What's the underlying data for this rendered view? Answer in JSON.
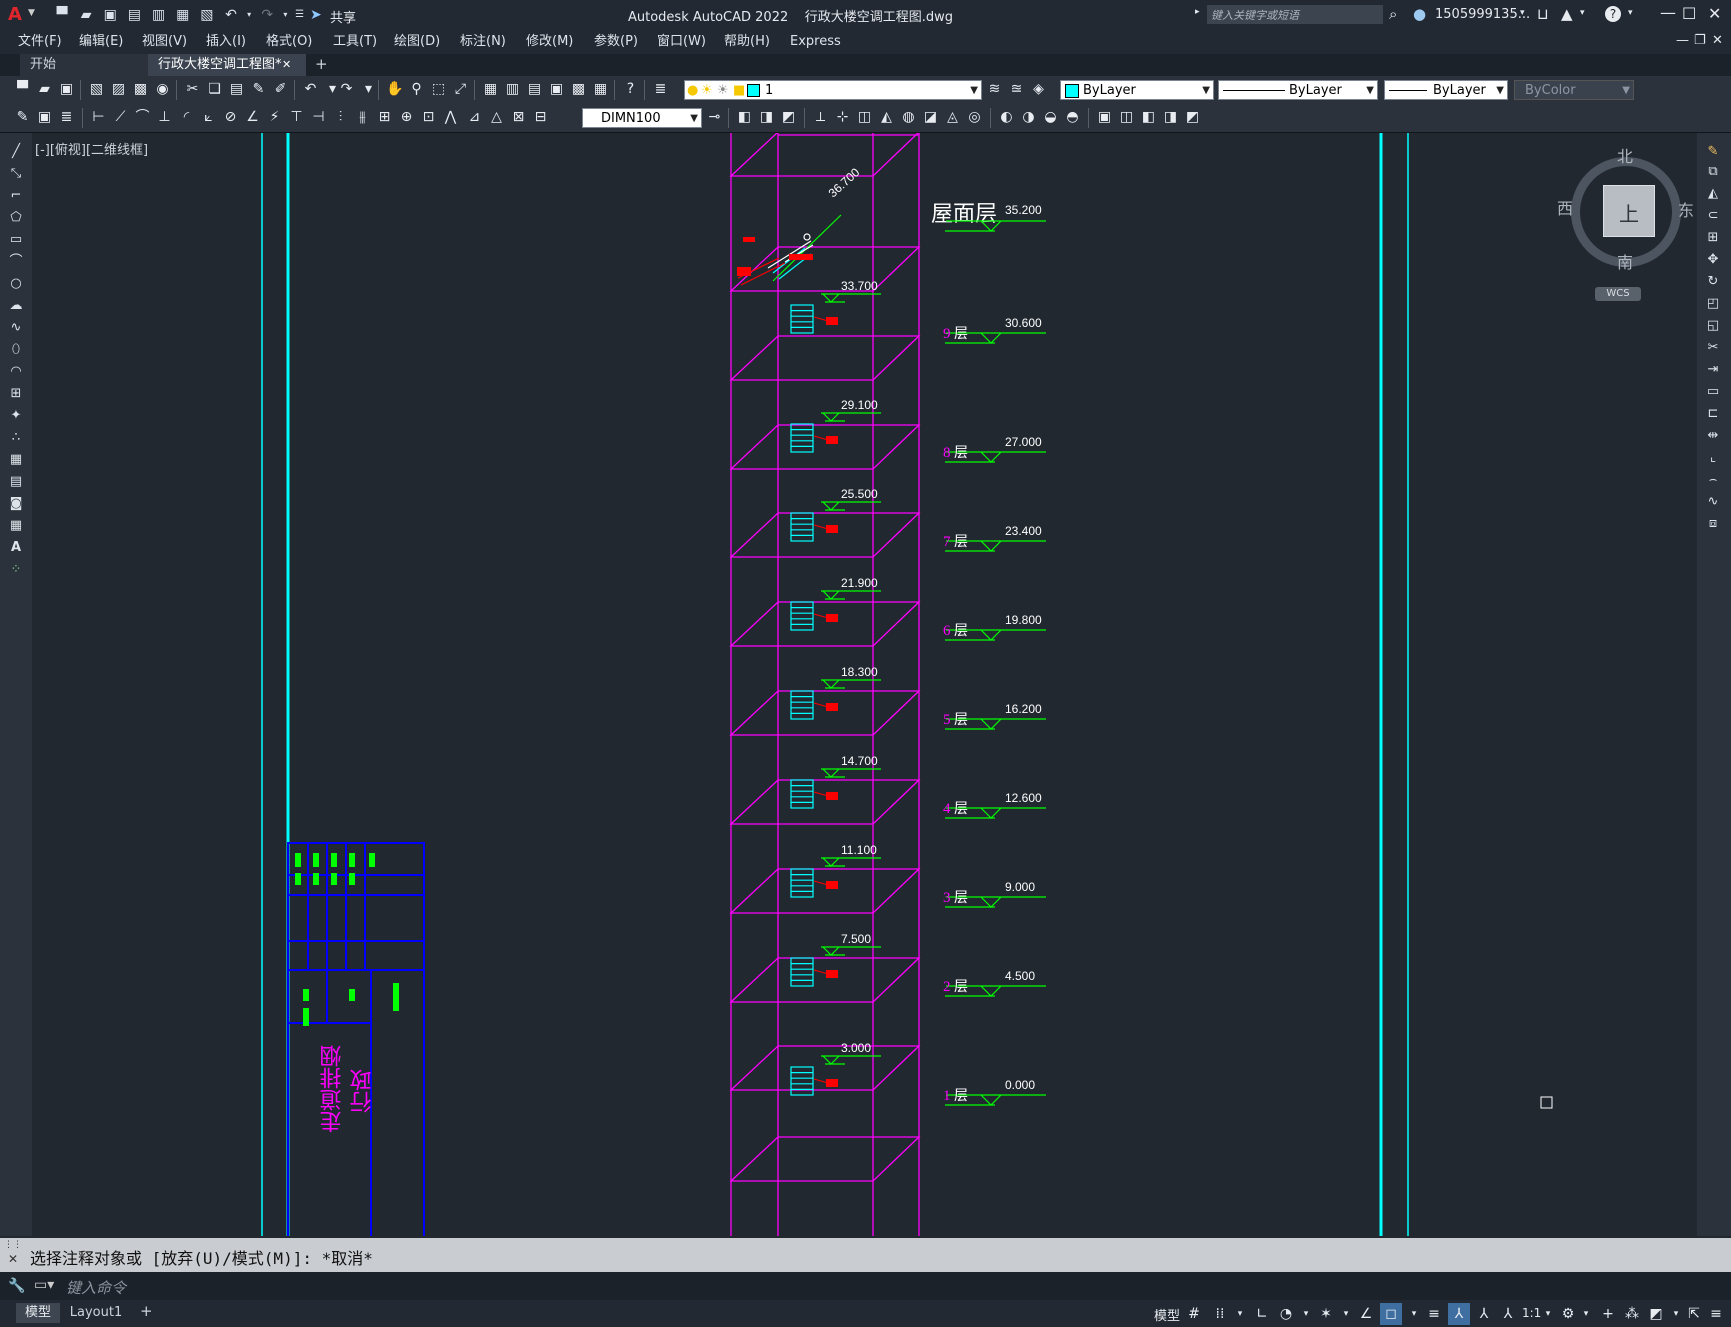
{
  "title_bar": {
    "app_letter": "A",
    "share_label": "共享",
    "title": "Autodesk AutoCAD 2022    行政大楼空调工程图.dwg",
    "search_placeholder": "键入关键字或短语",
    "user": "1505999135...",
    "help": "?"
  },
  "menu": [
    "文件(F)",
    "编辑(E)",
    "视图(V)",
    "插入(I)",
    "格式(O)",
    "工具(T)",
    "绘图(D)",
    "标注(N)",
    "修改(M)",
    "参数(P)",
    "窗口(W)",
    "帮助(H)",
    "Express"
  ],
  "tabs": {
    "start": "开始",
    "active": "行政大楼空调工程图*",
    "close": "✕",
    "add": "+"
  },
  "toolbar": {
    "layer_value": "1",
    "color_value": "ByLayer",
    "linetype_value": "ByLayer",
    "lineweight_value": "ByLayer",
    "plotstyle_value": "ByColor",
    "dimstyle_value": "DIMN100"
  },
  "viewport_label": "[-][俯视][二维线框]",
  "viewcube": {
    "north": "北",
    "south": "南",
    "east": "东",
    "west": "西",
    "top": "上",
    "wcs": "WCS"
  },
  "drawing": {
    "roof_label": "屋面层",
    "roof_elev": "35.200",
    "top_elev": "36.700",
    "floors": [
      {
        "num": "9",
        "suffix": "层",
        "elev": "30.600",
        "pipe": "33.700"
      },
      {
        "num": "8",
        "suffix": "层",
        "elev": "27.000",
        "pipe": "29.100"
      },
      {
        "num": "7",
        "suffix": "层",
        "elev": "23.400",
        "pipe": "25.500"
      },
      {
        "num": "6",
        "suffix": "层",
        "elev": "19.800",
        "pipe": "21.900"
      },
      {
        "num": "5",
        "suffix": "层",
        "elev": "16.200",
        "pipe": "18.300"
      },
      {
        "num": "4",
        "suffix": "层",
        "elev": "12.600",
        "pipe": "14.700"
      },
      {
        "num": "3",
        "suffix": "层",
        "elev": "9.000",
        "pipe": "11.100"
      },
      {
        "num": "2",
        "suffix": "层",
        "elev": "4.500",
        "pipe": "7.500"
      },
      {
        "num": "1",
        "suffix": "层",
        "elev": "0.000",
        "pipe": "3.000"
      }
    ],
    "titleblock_text_1": "走道排烟",
    "titleblock_text_2": "行政"
  },
  "command": {
    "history": "选择注释对象或 [放弃(U)/模式(M)]: *取消*",
    "placeholder": "键入命令"
  },
  "status": {
    "model_tab": "模型",
    "layout_tab": "Layout1",
    "add": "+",
    "model_btn": "模型",
    "scale": "1:1"
  },
  "colors": {
    "magenta": "#ff00ff",
    "green": "#00ff00",
    "cyan": "#00ffff",
    "red": "#ff0000",
    "blue": "#0000ff",
    "background": "#212830"
  }
}
